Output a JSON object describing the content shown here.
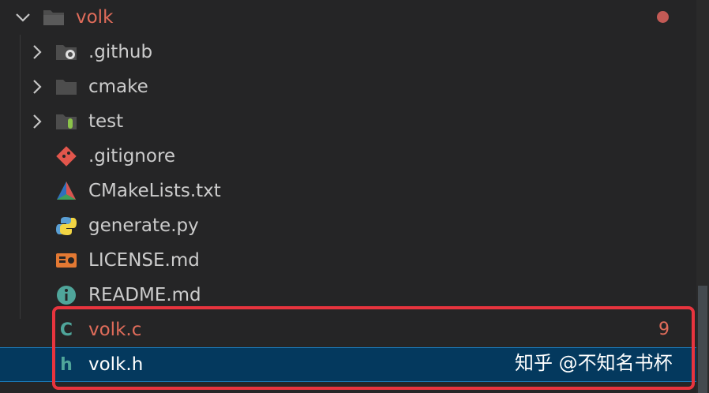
{
  "explorer": {
    "root": {
      "label": "volk",
      "color": "#e06c5a",
      "modified_dot_color": "#c35a55"
    },
    "items": [
      {
        "label": ".github",
        "type": "folder",
        "icon": "github-folder-icon"
      },
      {
        "label": "cmake",
        "type": "folder",
        "icon": "folder-icon"
      },
      {
        "label": "test",
        "type": "folder",
        "icon": "test-folder-icon"
      },
      {
        "label": ".gitignore",
        "type": "file",
        "icon": "git-icon"
      },
      {
        "label": "CMakeLists.txt",
        "type": "file",
        "icon": "cmake-icon"
      },
      {
        "label": "generate.py",
        "type": "file",
        "icon": "python-icon"
      },
      {
        "label": "LICENSE.md",
        "type": "file",
        "icon": "license-icon"
      },
      {
        "label": "README.md",
        "type": "file",
        "icon": "info-icon"
      },
      {
        "label": "volk.c",
        "type": "file",
        "icon": "c-file-icon",
        "badge": "9",
        "color": "#e06c5a"
      },
      {
        "label": "volk.h",
        "type": "file",
        "icon": "h-file-icon",
        "selected": true
      }
    ]
  },
  "watermark": {
    "text": "知乎 @不知名书杯"
  },
  "colors": {
    "background": "#252526",
    "selected_background": "#04395e",
    "error_red": "#e06c5a",
    "highlight_box": "#e8343e"
  }
}
